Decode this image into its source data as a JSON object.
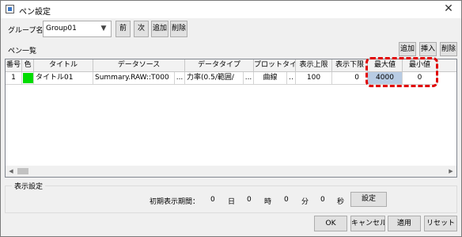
{
  "window": {
    "title": "ペン設定",
    "close_glyph": "✕"
  },
  "group": {
    "label": "グループ名",
    "value": "Group01",
    "dropdown_glyph": "▼",
    "buttons": {
      "prev": "前",
      "next": "次",
      "add": "追加",
      "delete": "削除"
    }
  },
  "pen_list": {
    "label": "ペン一覧",
    "buttons": {
      "add": "追加",
      "insert": "挿入",
      "delete": "削除"
    },
    "columns": [
      "番号",
      "色",
      "タイトル",
      "データソース",
      "データタイプ",
      "プロットタイプ",
      "表示上限",
      "表示下限",
      "最大値",
      "最小値"
    ],
    "rows": [
      {
        "number": "1",
        "color": "#00dc00",
        "title": "タイトル01",
        "data_source": "Summary.RAW::T000",
        "data_type": "力率(0.5/範囲/",
        "plot_type": "曲線",
        "upper": "100",
        "lower": "0",
        "max": "4000",
        "min": "0"
      }
    ],
    "ellipsis": "...",
    "ellipsis_short": ".."
  },
  "display": {
    "label": "表示設定",
    "initial_period_label": "初期表示期間：",
    "days": "0",
    "days_unit": "日",
    "hours": "0",
    "hours_unit": "時",
    "minutes": "0",
    "minutes_unit": "分",
    "seconds": "0",
    "seconds_unit": "秒",
    "set_button": "設定"
  },
  "footer": {
    "ok": "OK",
    "cancel": "キャンセル",
    "apply": "適用",
    "reset": "リセット"
  },
  "colors": {
    "highlight": "#e00000",
    "selected_cell": "#b8cce4"
  }
}
